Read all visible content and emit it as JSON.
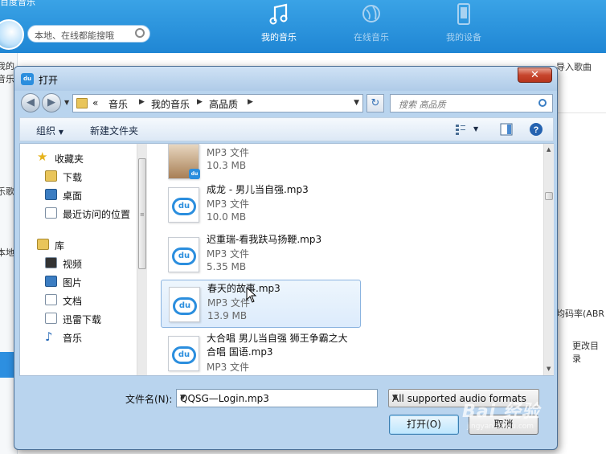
{
  "app": {
    "brand": "百度音乐",
    "search_placeholder": "本地、在线都能搜哦",
    "nav": [
      {
        "label": "我的音乐",
        "icon": "music-note-icon"
      },
      {
        "label": "在线音乐",
        "icon": "globe-icon"
      },
      {
        "label": "我的设备",
        "icon": "phone-icon"
      }
    ],
    "side_labels": [
      "我的音乐",
      "乐歌",
      "本地"
    ],
    "right_import": "导入歌曲",
    "right_bitrate": "均码率(ABR",
    "right_change": "更改目录"
  },
  "dialog": {
    "title": "打开",
    "close": "✕",
    "breadcrumbs": [
      "音乐",
      "我的音乐",
      "高品质"
    ],
    "crumb_prefix": "«",
    "search_placeholder": "搜索 高品质",
    "toolbar": {
      "organize": "组织",
      "new_folder": "新建文件夹"
    },
    "nav": {
      "favorites": "收藏夹",
      "fav_items": [
        "下载",
        "桌面",
        "最近访问的位置"
      ],
      "libraries": "库",
      "lib_items": [
        "视频",
        "图片",
        "文档",
        "迅雷下载",
        "音乐"
      ]
    },
    "files": [
      {
        "name": "",
        "type": "MP3 文件",
        "size": "10.3 MB",
        "icon": "owl-thumbnail-icon"
      },
      {
        "name": "成龙 - 男儿当自强.mp3",
        "type": "MP3 文件",
        "size": "10.0 MB",
        "icon": "du-audio-file-icon"
      },
      {
        "name": "迟重瑞-看我趺马扬鞭.mp3",
        "type": "MP3 文件",
        "size": "5.35 MB",
        "icon": "du-audio-file-icon"
      },
      {
        "name": "春天的故事.mp3",
        "type": "MP3 文件",
        "size": "13.9 MB",
        "icon": "du-audio-file-icon",
        "selected": true
      },
      {
        "name": "大合唱 男儿当自强 狮王争霸之大",
        "name2": "合唱 国语.mp3",
        "type": "MP3 文件",
        "size": "",
        "icon": "du-audio-file-icon"
      }
    ],
    "filename_label": "文件名(N):",
    "filename_value": "QQSG—Login.mp3",
    "filetype_value": "All supported audio formats",
    "open_button": "打开(O)",
    "cancel_button": "取消"
  },
  "watermark": {
    "text": "Bai 经验",
    "sub": "jingyan.baidu.com"
  }
}
